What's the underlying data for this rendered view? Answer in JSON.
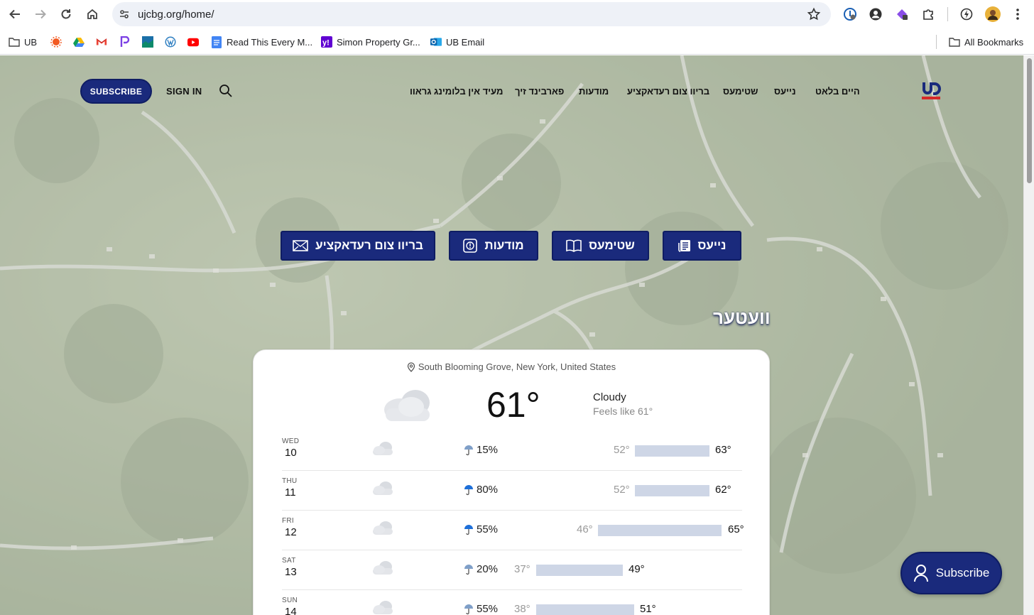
{
  "browser": {
    "url": "ujcbg.org/home/",
    "bookmarks": [
      {
        "label": "UB",
        "icon": "folder-icon"
      },
      {
        "label": "",
        "icon": "sun-app-icon"
      },
      {
        "label": "",
        "icon": "google-drive-icon"
      },
      {
        "label": "",
        "icon": "gmail-icon"
      },
      {
        "label": "",
        "icon": "p-app-icon"
      },
      {
        "label": "",
        "icon": "landscape-app-icon"
      },
      {
        "label": "",
        "icon": "wordpress-icon"
      },
      {
        "label": "",
        "icon": "youtube-icon"
      },
      {
        "label": "Read This Every M...",
        "icon": "docs-icon"
      },
      {
        "label": "Simon Property Gr...",
        "icon": "yahoo-icon"
      },
      {
        "label": "UB Email",
        "icon": "outlook-icon"
      }
    ],
    "all_bookmarks": "All Bookmarks"
  },
  "site": {
    "subscribe": "SUBSCRIBE",
    "sign_in": "SIGN IN",
    "nav": [
      "היים בלאט",
      "נייעס",
      "שטימעס",
      "בריוו צום רעדאקציע",
      "מודעות",
      "פארבינד זיך",
      "מעיד אין בלומינג גראוו"
    ],
    "cta": {
      "news": "נייעס",
      "voices": "שטימעס",
      "ads": "מודעות",
      "letter": "בריוו צום רעדאקציע"
    },
    "weather_title": "וועטער",
    "float_subscribe": "Subscribe"
  },
  "weather": {
    "location": "South Blooming Grove, New York, United States",
    "temp": "61°",
    "condition": "Cloudy",
    "feels_like": "Feels like 61°",
    "forecast": [
      {
        "dow": "WED",
        "day": "10",
        "precip": "15%",
        "low": "52°",
        "high": "63°"
      },
      {
        "dow": "THU",
        "day": "11",
        "precip": "80%",
        "low": "52°",
        "high": "62°"
      },
      {
        "dow": "FRI",
        "day": "12",
        "precip": "55%",
        "low": "46°",
        "high": "65°"
      },
      {
        "dow": "SAT",
        "day": "13",
        "precip": "20%",
        "low": "37°",
        "high": "49°"
      },
      {
        "dow": "SUN",
        "day": "14",
        "precip": "55%",
        "low": "38°",
        "high": "51°"
      }
    ]
  }
}
